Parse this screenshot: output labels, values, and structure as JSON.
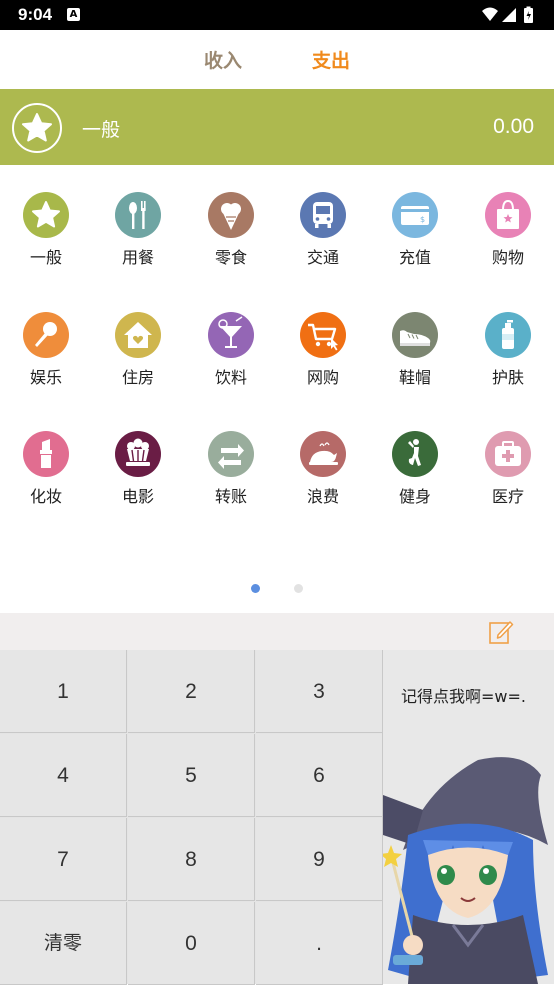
{
  "status_bar": {
    "time": "9:04",
    "notification_icon": "A",
    "icons": [
      "wifi-icon",
      "signal-icon",
      "battery-icon"
    ]
  },
  "tabs": [
    {
      "label": "收入",
      "color": "#9a8871",
      "active": false
    },
    {
      "label": "支出",
      "color": "#f08a1c",
      "active": true
    }
  ],
  "selected": {
    "name": "一般",
    "amount": "0.00",
    "color": "#adb94f",
    "icon": "star-icon"
  },
  "categories": [
    {
      "label": "一般",
      "icon": "star-icon",
      "color": "#a8b84a"
    },
    {
      "label": "用餐",
      "icon": "cutlery-icon",
      "color": "#6fa5a3"
    },
    {
      "label": "零食",
      "icon": "icecream-icon",
      "color": "#a87964"
    },
    {
      "label": "交通",
      "icon": "bus-icon",
      "color": "#5b78b2"
    },
    {
      "label": "充值",
      "icon": "card-icon",
      "color": "#7bb7df"
    },
    {
      "label": "购物",
      "icon": "shopping-bag-icon",
      "color": "#e882b6"
    },
    {
      "label": "娱乐",
      "icon": "microphone-icon",
      "color": "#ef8d3b"
    },
    {
      "label": "住房",
      "icon": "house-icon",
      "color": "#cfb64e"
    },
    {
      "label": "饮料",
      "icon": "cocktail-icon",
      "color": "#9466b5"
    },
    {
      "label": "网购",
      "icon": "cart-icon",
      "color": "#f06f13"
    },
    {
      "label": "鞋帽",
      "icon": "shoe-icon",
      "color": "#7c8671"
    },
    {
      "label": "护肤",
      "icon": "lotion-icon",
      "color": "#5ab0c9"
    },
    {
      "label": "化妆",
      "icon": "lipstick-icon",
      "color": "#e16d90"
    },
    {
      "label": "电影",
      "icon": "popcorn-icon",
      "color": "#6a1d45"
    },
    {
      "label": "转账",
      "icon": "transfer-icon",
      "color": "#99ad9c"
    },
    {
      "label": "浪费",
      "icon": "roast-chicken-icon",
      "color": "#b66a68"
    },
    {
      "label": "健身",
      "icon": "yoga-icon",
      "color": "#3a6b3a"
    },
    {
      "label": "医疗",
      "icon": "medkit-icon",
      "color": "#df9bb0"
    }
  ],
  "pager": {
    "pages": 2,
    "current": 1
  },
  "memo": {
    "icon": "edit-note-icon"
  },
  "keypad": {
    "keys": [
      "1",
      "2",
      "3",
      "4",
      "5",
      "6",
      "7",
      "8",
      "9",
      "清零",
      "0",
      "."
    ]
  },
  "side_panel": {
    "hint": "记得点我啊=w=."
  }
}
